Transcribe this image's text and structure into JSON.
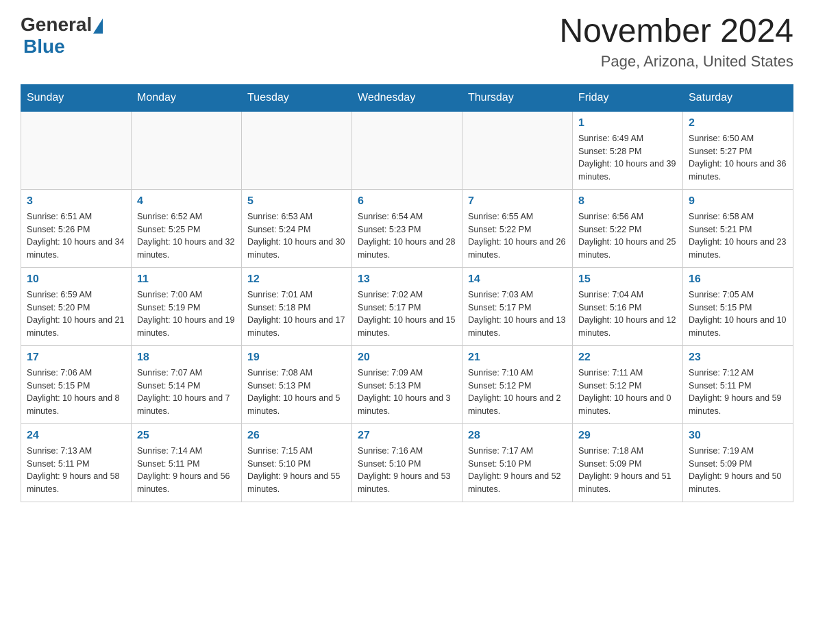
{
  "logo": {
    "general": "General",
    "blue": "Blue"
  },
  "title": "November 2024",
  "subtitle": "Page, Arizona, United States",
  "days_of_week": [
    "Sunday",
    "Monday",
    "Tuesday",
    "Wednesday",
    "Thursday",
    "Friday",
    "Saturday"
  ],
  "weeks": [
    [
      {
        "day": "",
        "info": ""
      },
      {
        "day": "",
        "info": ""
      },
      {
        "day": "",
        "info": ""
      },
      {
        "day": "",
        "info": ""
      },
      {
        "day": "",
        "info": ""
      },
      {
        "day": "1",
        "info": "Sunrise: 6:49 AM\nSunset: 5:28 PM\nDaylight: 10 hours and 39 minutes."
      },
      {
        "day": "2",
        "info": "Sunrise: 6:50 AM\nSunset: 5:27 PM\nDaylight: 10 hours and 36 minutes."
      }
    ],
    [
      {
        "day": "3",
        "info": "Sunrise: 6:51 AM\nSunset: 5:26 PM\nDaylight: 10 hours and 34 minutes."
      },
      {
        "day": "4",
        "info": "Sunrise: 6:52 AM\nSunset: 5:25 PM\nDaylight: 10 hours and 32 minutes."
      },
      {
        "day": "5",
        "info": "Sunrise: 6:53 AM\nSunset: 5:24 PM\nDaylight: 10 hours and 30 minutes."
      },
      {
        "day": "6",
        "info": "Sunrise: 6:54 AM\nSunset: 5:23 PM\nDaylight: 10 hours and 28 minutes."
      },
      {
        "day": "7",
        "info": "Sunrise: 6:55 AM\nSunset: 5:22 PM\nDaylight: 10 hours and 26 minutes."
      },
      {
        "day": "8",
        "info": "Sunrise: 6:56 AM\nSunset: 5:22 PM\nDaylight: 10 hours and 25 minutes."
      },
      {
        "day": "9",
        "info": "Sunrise: 6:58 AM\nSunset: 5:21 PM\nDaylight: 10 hours and 23 minutes."
      }
    ],
    [
      {
        "day": "10",
        "info": "Sunrise: 6:59 AM\nSunset: 5:20 PM\nDaylight: 10 hours and 21 minutes."
      },
      {
        "day": "11",
        "info": "Sunrise: 7:00 AM\nSunset: 5:19 PM\nDaylight: 10 hours and 19 minutes."
      },
      {
        "day": "12",
        "info": "Sunrise: 7:01 AM\nSunset: 5:18 PM\nDaylight: 10 hours and 17 minutes."
      },
      {
        "day": "13",
        "info": "Sunrise: 7:02 AM\nSunset: 5:17 PM\nDaylight: 10 hours and 15 minutes."
      },
      {
        "day": "14",
        "info": "Sunrise: 7:03 AM\nSunset: 5:17 PM\nDaylight: 10 hours and 13 minutes."
      },
      {
        "day": "15",
        "info": "Sunrise: 7:04 AM\nSunset: 5:16 PM\nDaylight: 10 hours and 12 minutes."
      },
      {
        "day": "16",
        "info": "Sunrise: 7:05 AM\nSunset: 5:15 PM\nDaylight: 10 hours and 10 minutes."
      }
    ],
    [
      {
        "day": "17",
        "info": "Sunrise: 7:06 AM\nSunset: 5:15 PM\nDaylight: 10 hours and 8 minutes."
      },
      {
        "day": "18",
        "info": "Sunrise: 7:07 AM\nSunset: 5:14 PM\nDaylight: 10 hours and 7 minutes."
      },
      {
        "day": "19",
        "info": "Sunrise: 7:08 AM\nSunset: 5:13 PM\nDaylight: 10 hours and 5 minutes."
      },
      {
        "day": "20",
        "info": "Sunrise: 7:09 AM\nSunset: 5:13 PM\nDaylight: 10 hours and 3 minutes."
      },
      {
        "day": "21",
        "info": "Sunrise: 7:10 AM\nSunset: 5:12 PM\nDaylight: 10 hours and 2 minutes."
      },
      {
        "day": "22",
        "info": "Sunrise: 7:11 AM\nSunset: 5:12 PM\nDaylight: 10 hours and 0 minutes."
      },
      {
        "day": "23",
        "info": "Sunrise: 7:12 AM\nSunset: 5:11 PM\nDaylight: 9 hours and 59 minutes."
      }
    ],
    [
      {
        "day": "24",
        "info": "Sunrise: 7:13 AM\nSunset: 5:11 PM\nDaylight: 9 hours and 58 minutes."
      },
      {
        "day": "25",
        "info": "Sunrise: 7:14 AM\nSunset: 5:11 PM\nDaylight: 9 hours and 56 minutes."
      },
      {
        "day": "26",
        "info": "Sunrise: 7:15 AM\nSunset: 5:10 PM\nDaylight: 9 hours and 55 minutes."
      },
      {
        "day": "27",
        "info": "Sunrise: 7:16 AM\nSunset: 5:10 PM\nDaylight: 9 hours and 53 minutes."
      },
      {
        "day": "28",
        "info": "Sunrise: 7:17 AM\nSunset: 5:10 PM\nDaylight: 9 hours and 52 minutes."
      },
      {
        "day": "29",
        "info": "Sunrise: 7:18 AM\nSunset: 5:09 PM\nDaylight: 9 hours and 51 minutes."
      },
      {
        "day": "30",
        "info": "Sunrise: 7:19 AM\nSunset: 5:09 PM\nDaylight: 9 hours and 50 minutes."
      }
    ]
  ]
}
